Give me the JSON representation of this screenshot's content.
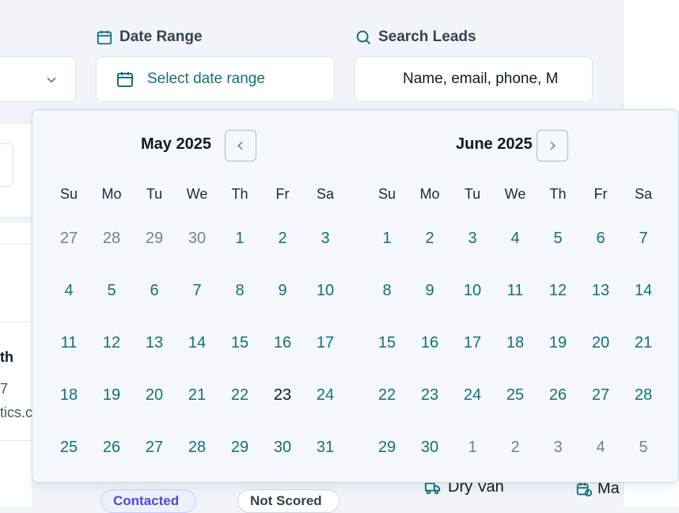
{
  "filters": {
    "date_range_label": "Date Range",
    "date_range_placeholder": "Select date range",
    "search_label": "Search Leads",
    "search_value": "Name, email, phone, M"
  },
  "background": {
    "name_fragment": "th",
    "phone_fragment": "7",
    "email_fragment": "tics.c",
    "equipment": "Dry Van",
    "extra": "Ma",
    "status_badge": "Contacted",
    "score_badge": "Not Scored"
  },
  "calendar": {
    "weekdays": [
      "Su",
      "Mo",
      "Tu",
      "We",
      "Th",
      "Fr",
      "Sa"
    ],
    "months": [
      {
        "title": "May 2025",
        "weeks": [
          [
            {
              "d": "27",
              "out": true
            },
            {
              "d": "28",
              "out": true
            },
            {
              "d": "29",
              "out": true
            },
            {
              "d": "30",
              "out": true
            },
            {
              "d": "1"
            },
            {
              "d": "2"
            },
            {
              "d": "3"
            }
          ],
          [
            {
              "d": "4"
            },
            {
              "d": "5"
            },
            {
              "d": "6"
            },
            {
              "d": "7"
            },
            {
              "d": "8"
            },
            {
              "d": "9"
            },
            {
              "d": "10"
            }
          ],
          [
            {
              "d": "11"
            },
            {
              "d": "12"
            },
            {
              "d": "13"
            },
            {
              "d": "14"
            },
            {
              "d": "15"
            },
            {
              "d": "16"
            },
            {
              "d": "17"
            }
          ],
          [
            {
              "d": "18"
            },
            {
              "d": "19"
            },
            {
              "d": "20"
            },
            {
              "d": "21"
            },
            {
              "d": "22"
            },
            {
              "d": "23",
              "today": true
            },
            {
              "d": "24"
            }
          ],
          [
            {
              "d": "25"
            },
            {
              "d": "26"
            },
            {
              "d": "27"
            },
            {
              "d": "28"
            },
            {
              "d": "29"
            },
            {
              "d": "30"
            },
            {
              "d": "31"
            }
          ]
        ]
      },
      {
        "title": "June 2025",
        "weeks": [
          [
            {
              "d": "1"
            },
            {
              "d": "2"
            },
            {
              "d": "3"
            },
            {
              "d": "4"
            },
            {
              "d": "5"
            },
            {
              "d": "6"
            },
            {
              "d": "7"
            }
          ],
          [
            {
              "d": "8"
            },
            {
              "d": "9"
            },
            {
              "d": "10"
            },
            {
              "d": "11"
            },
            {
              "d": "12"
            },
            {
              "d": "13"
            },
            {
              "d": "14"
            }
          ],
          [
            {
              "d": "15"
            },
            {
              "d": "16"
            },
            {
              "d": "17"
            },
            {
              "d": "18"
            },
            {
              "d": "19"
            },
            {
              "d": "20"
            },
            {
              "d": "21"
            }
          ],
          [
            {
              "d": "22"
            },
            {
              "d": "23"
            },
            {
              "d": "24"
            },
            {
              "d": "25"
            },
            {
              "d": "26"
            },
            {
              "d": "27"
            },
            {
              "d": "28"
            }
          ],
          [
            {
              "d": "29"
            },
            {
              "d": "30"
            },
            {
              "d": "1",
              "out": true
            },
            {
              "d": "2",
              "out": true
            },
            {
              "d": "3",
              "out": true
            },
            {
              "d": "4",
              "out": true
            },
            {
              "d": "5",
              "out": true
            }
          ]
        ]
      }
    ]
  },
  "colors": {
    "accent": "#166f77",
    "muted_day": "#7a8089",
    "popover_border": "#bfd7e4"
  }
}
